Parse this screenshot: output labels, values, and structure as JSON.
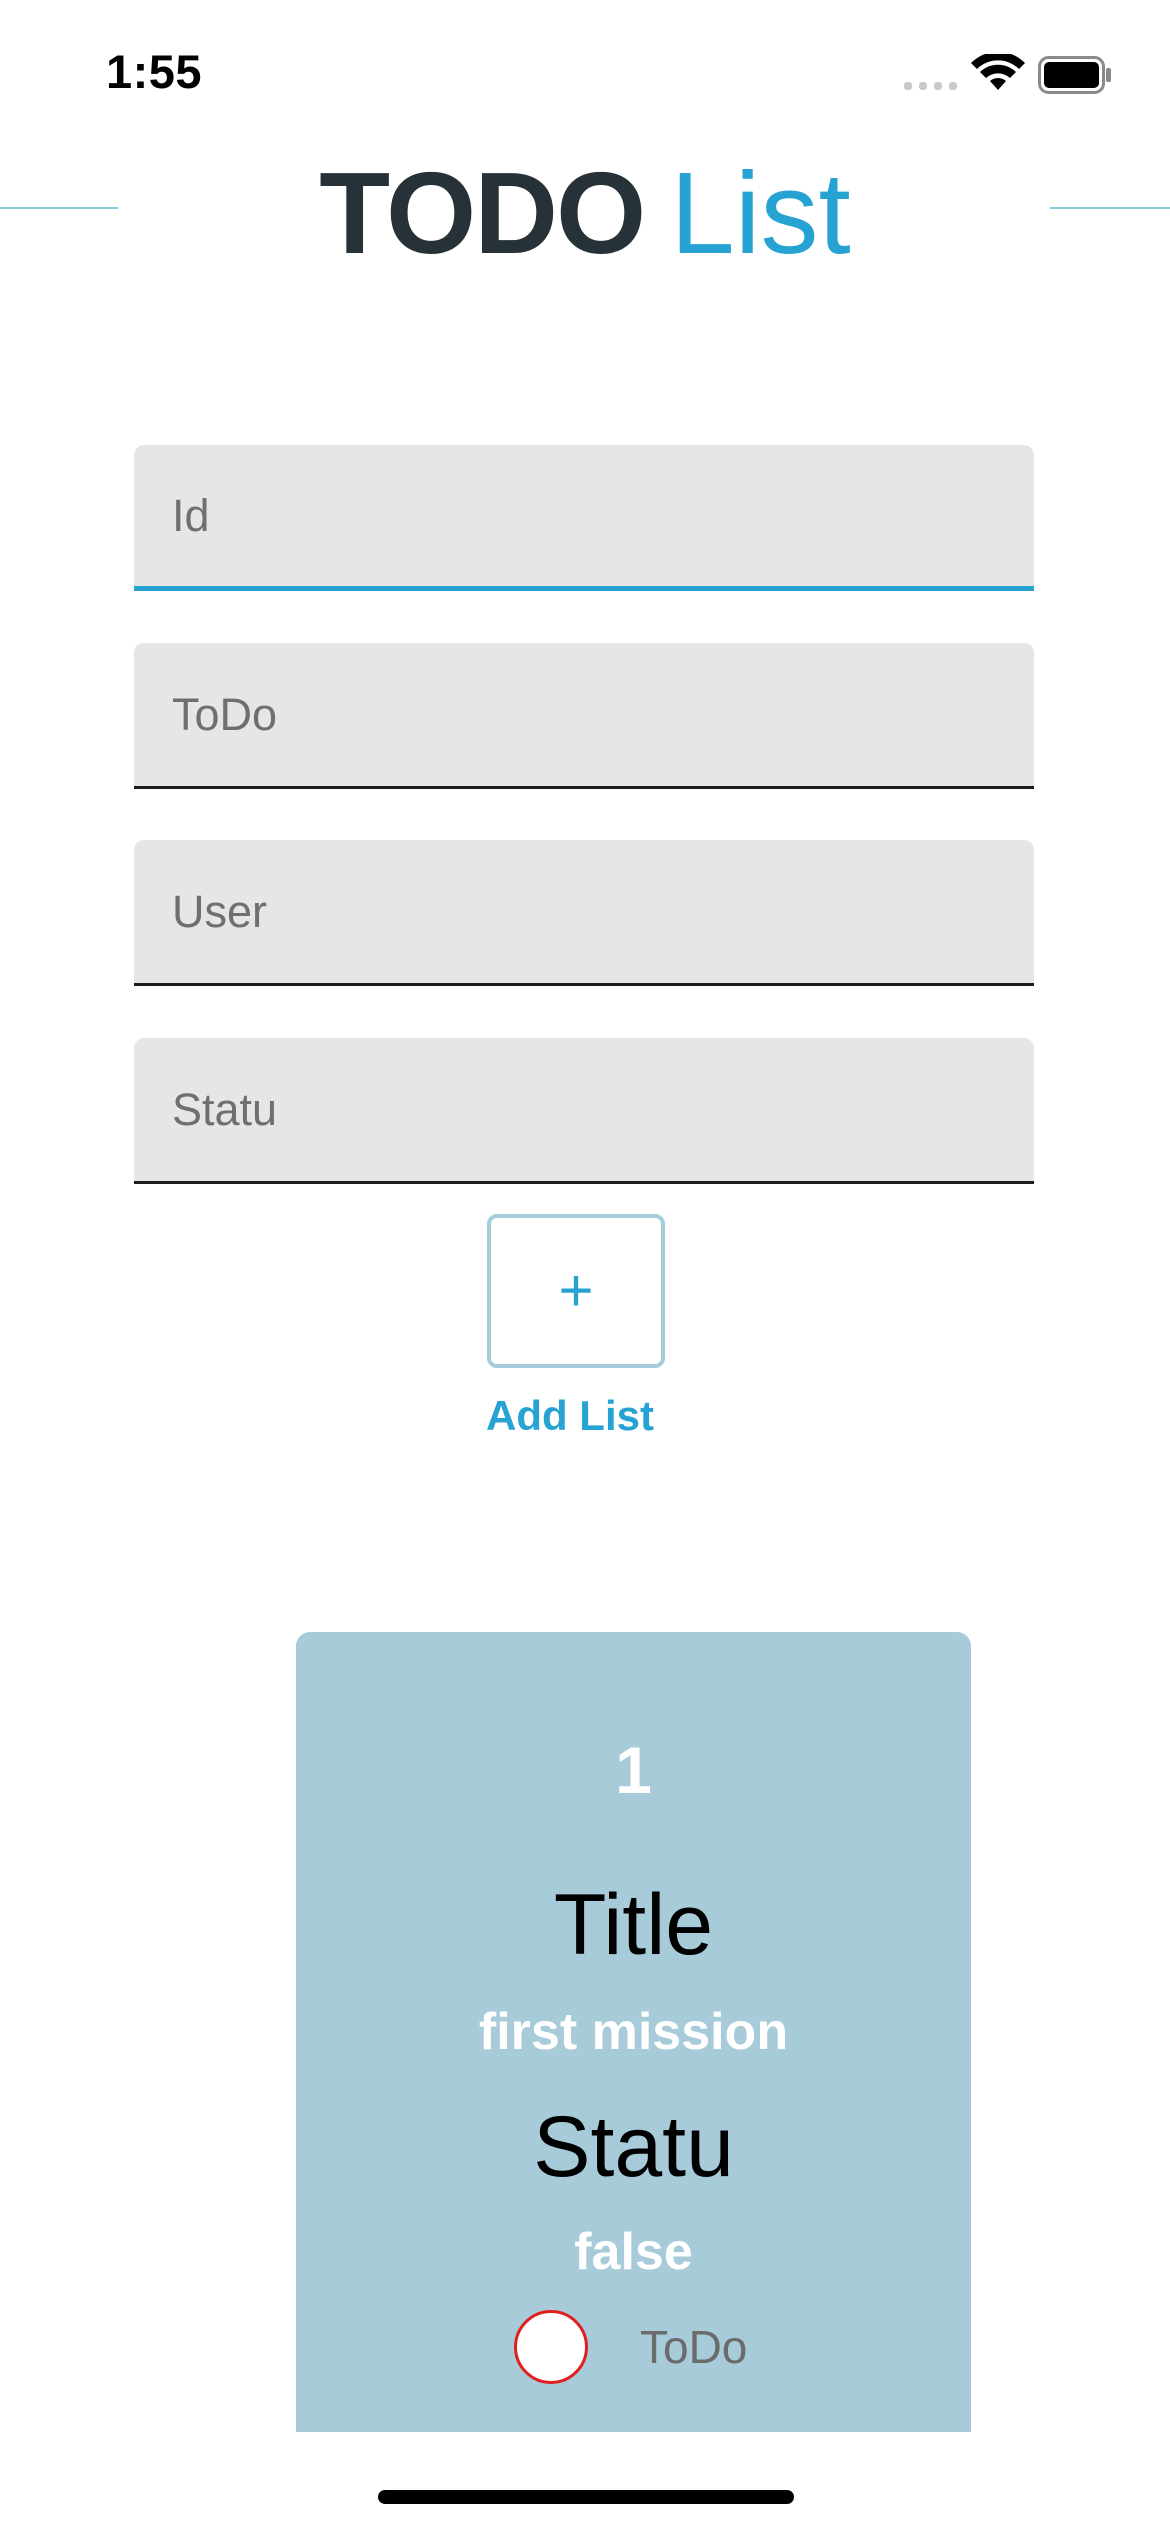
{
  "status_bar": {
    "time": "1:55"
  },
  "header": {
    "title_bold": "TODO",
    "title_light": "List"
  },
  "form": {
    "fields": [
      {
        "placeholder": "Id",
        "value": ""
      },
      {
        "placeholder": "ToDo",
        "value": ""
      },
      {
        "placeholder": "User",
        "value": ""
      },
      {
        "placeholder": "Statu",
        "value": ""
      }
    ],
    "add_button_icon": "+",
    "add_button_label": "Add List"
  },
  "todo_items": [
    {
      "id": "1",
      "title_label": "Title",
      "title_value": "first mission",
      "status_label": "Statu",
      "status_value": "false",
      "radio_label": "ToDo"
    }
  ],
  "colors": {
    "accent": "#27a3d3",
    "title_dark": "#263238",
    "card_bg": "#a8cbd9",
    "field_bg": "#e6e6e6",
    "radio_border": "#e0201f"
  },
  "icons": [
    "wifi-icon",
    "battery-icon",
    "cellular-signal-icon",
    "plus-icon"
  ]
}
